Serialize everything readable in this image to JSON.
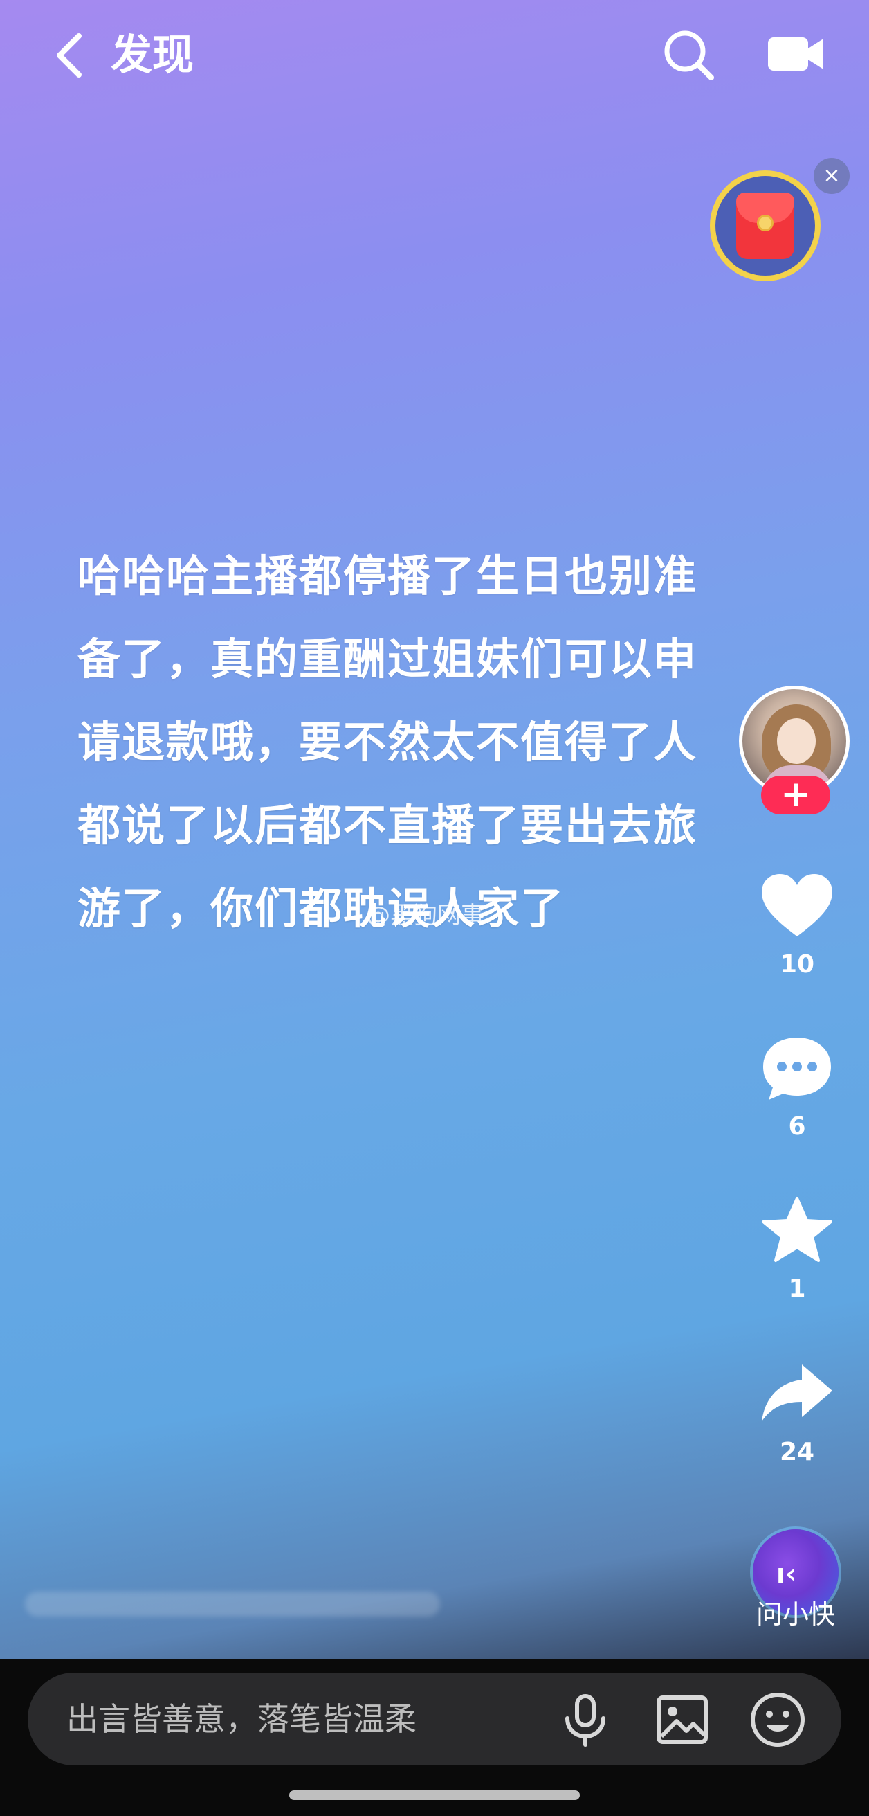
{
  "header": {
    "back_icon": "chevron-left-icon",
    "title": "发现",
    "search_icon": "search-icon",
    "camera_icon": "video-camera-icon"
  },
  "red_packet": {
    "icon": "red-envelope-icon",
    "close_label": "×"
  },
  "post": {
    "text": "哈哈哈主播都停播了生日也别准备了，真的重酬过姐妹们可以申请退款哦，要不然太不值得了人都说了以后都不直播了要出去旅游了，你们都耽误人家了",
    "watermark": "@黑狗网事"
  },
  "actions": {
    "follow_label": "+",
    "like_count": "10",
    "comment_count": "6",
    "favorite_count": "1",
    "share_count": "24",
    "ai_eyes": "ı‹",
    "ai_label": "问小快"
  },
  "input": {
    "placeholder": "出言皆善意，落笔皆温柔",
    "mic_icon": "microphone-icon",
    "image_icon": "image-icon",
    "emoji_icon": "emoji-icon"
  },
  "colors": {
    "accent_red": "#fe2c55",
    "bg_top": "#a58af0",
    "bg_mid": "#68a8e6"
  }
}
